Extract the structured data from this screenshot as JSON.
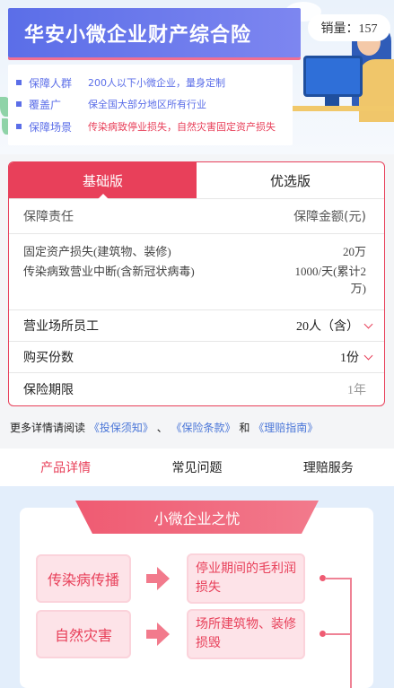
{
  "banner": {
    "title": "华安小微企业财产综合险",
    "sales": "销量：157",
    "info": [
      {
        "key": "保障人群",
        "value": "200人以下小微企业，量身定制",
        "highlight": false
      },
      {
        "key": "覆盖广",
        "value": "保全国大部分地区所有行业",
        "highlight": false
      },
      {
        "key": "保障场景",
        "value": "传染病致停业损失，自然灾害固定资产损失",
        "highlight": true
      }
    ]
  },
  "plan": {
    "tabs": [
      "基础版",
      "优选版"
    ],
    "active_tab": 0,
    "coverage_header": {
      "left": "保障责任",
      "right": "保障金额(元)"
    },
    "coverage_items": [
      {
        "name": "固定资产损失(建筑物、装修)",
        "amount": "20万"
      },
      {
        "name": "传染病致营业中断(含新冠状病毒)",
        "amount": "1000/天(累计2万)"
      }
    ],
    "options": [
      {
        "label": "营业场所员工",
        "value": "20人（含）",
        "dropdown": true
      },
      {
        "label": "购买份数",
        "value": "1份",
        "dropdown": true
      },
      {
        "label": "保险期限",
        "value": "1年",
        "dropdown": false
      }
    ]
  },
  "more_info": {
    "prefix": "更多详情请阅读",
    "link1": "《投保须知》",
    "sep": "、",
    "link2": "《保险条款》",
    "and": "和",
    "link3": "《理赔指南》"
  },
  "detail_tabs": [
    "产品详情",
    "常见问题",
    "理赔服务"
  ],
  "detail_active": 0,
  "worry": {
    "title": "小微企业之忧",
    "rows": [
      {
        "cause": "传染病传播",
        "effect": "停业期间的毛利润损失"
      },
      {
        "cause": "自然灾害",
        "effect": "场所建筑物、装修损毁"
      }
    ]
  },
  "colors": {
    "accent": "#e8405a",
    "brand_blue": "#5b6ee8",
    "link": "#4a76d8"
  }
}
